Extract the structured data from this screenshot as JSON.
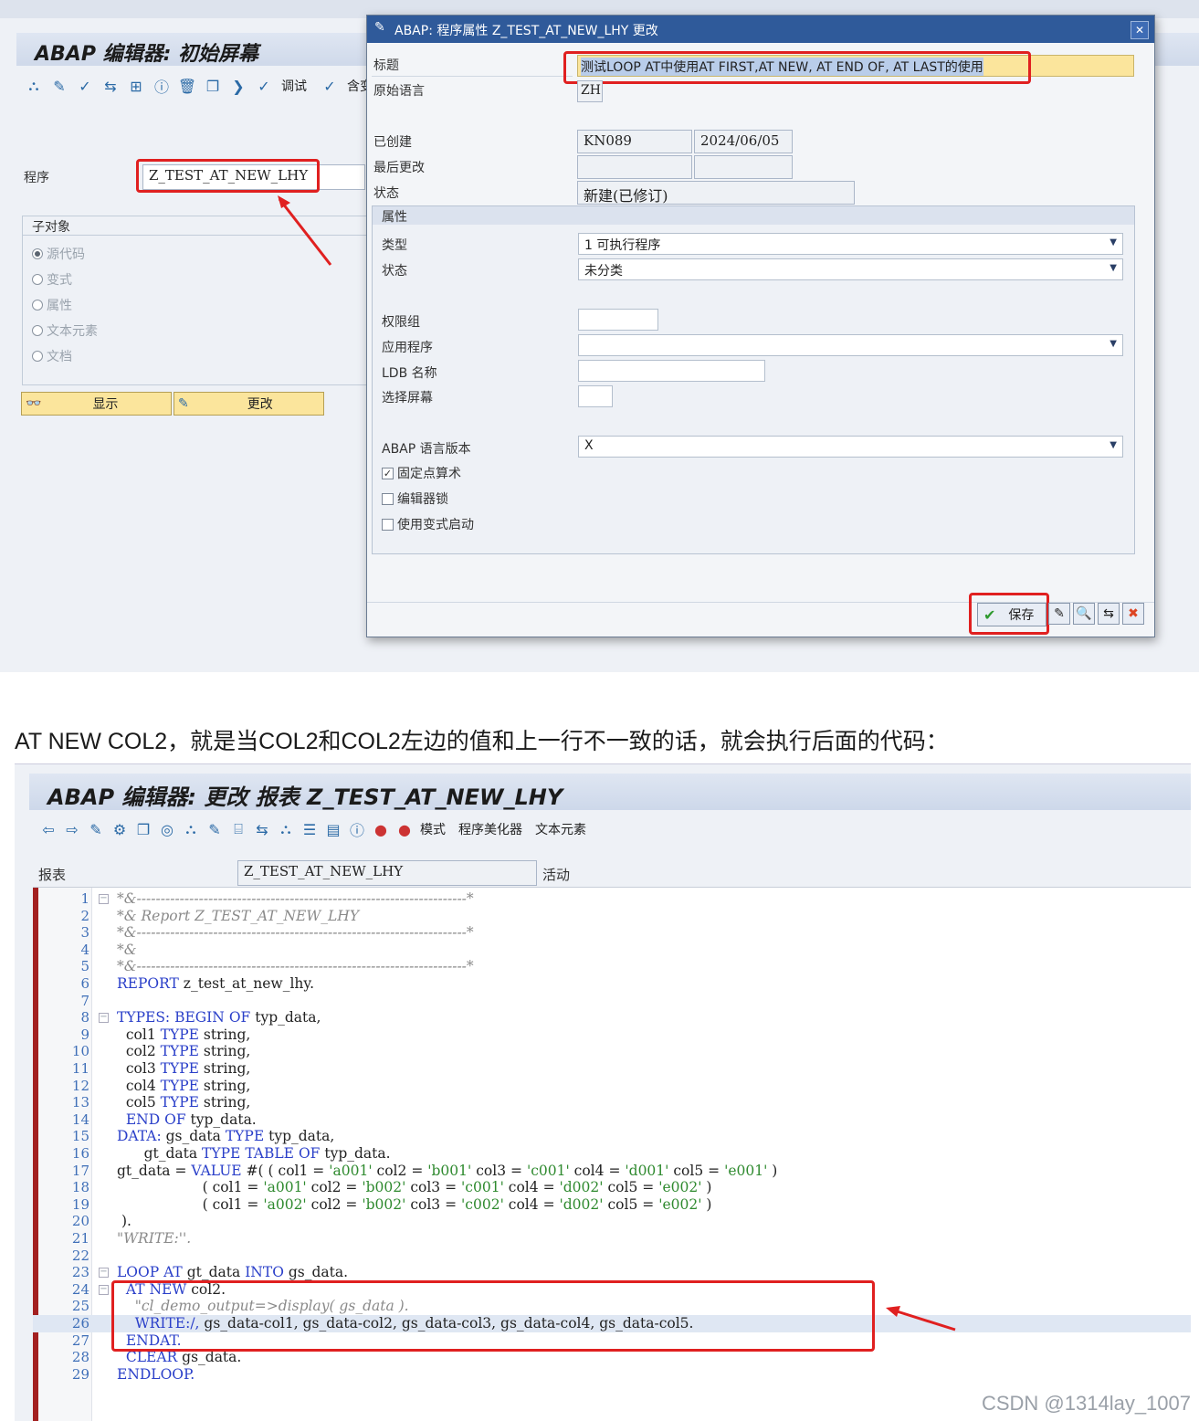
{
  "top": {
    "editor_title": "ABAP 编辑器: 初始屏幕",
    "toolbar": {
      "debug_label": "调试",
      "contains_label": "含变"
    },
    "program_label": "程序",
    "program_value": "Z_TEST_AT_NEW_LHY",
    "subobjects": {
      "title": "子对象",
      "options": [
        "源代码",
        "变式",
        "属性",
        "文本元素",
        "文档"
      ],
      "selected": "源代码"
    },
    "buttons": {
      "display": "显示",
      "change": "更改"
    },
    "dialog": {
      "title": "ABAP: 程序属性 Z_TEST_AT_NEW_LHY 更改",
      "title_label": "标题",
      "title_value": "测试LOOP AT中使用AT FIRST,AT NEW, AT END OF, AT LAST的使用",
      "orig_lang_label": "原始语言",
      "orig_lang_value": "ZH",
      "created_label": "已创建",
      "created_user": "KN089",
      "created_date": "2024/06/05",
      "last_changed_label": "最后更改",
      "status_label": "状态",
      "status_value": "新建(已修订)",
      "attributes_title": "属性",
      "type_label": "类型",
      "type_value": "1 可执行程序",
      "attr_status_label": "状态",
      "attr_status_value": "未分类",
      "auth_group_label": "权限组",
      "application_label": "应用程序",
      "ldb_label": "LDB 名称",
      "selscreen_label": "选择屏幕",
      "lang_version_label": "ABAP 语言版本",
      "lang_version_value": "X",
      "checkboxes": [
        {
          "label": "固定点算术",
          "checked": true
        },
        {
          "label": "编辑器锁",
          "checked": false
        },
        {
          "label": "使用变式启动",
          "checked": false
        }
      ],
      "save_label": "保存"
    }
  },
  "note": "AT NEW COL2，就是当COL2和COL2左边的值和上一行不一致的话，就会执行后面的代码：",
  "bottom": {
    "editor_title": "ABAP 编辑器: 更改 报表 Z_TEST_AT_NEW_LHY",
    "toolbar": {
      "mode_label": "模式",
      "beautifier_label": "程序美化器",
      "text_elements_label": "文本元素"
    },
    "report_label": "报表",
    "report_value": "Z_TEST_AT_NEW_LHY",
    "report_status": "活动",
    "code_lines": [
      "*&---------------------------------------------------------------------*",
      "*& Report Z_TEST_AT_NEW_LHY",
      "*&---------------------------------------------------------------------*",
      "*&",
      "*&---------------------------------------------------------------------*",
      "REPORT z_test_at_new_lhy.",
      "",
      "TYPES: BEGIN OF typ_data,",
      "  col1 TYPE string,",
      "  col2 TYPE string,",
      "  col3 TYPE string,",
      "  col4 TYPE string,",
      "  col5 TYPE string,",
      "  END OF typ_data.",
      "DATA: gs_data TYPE typ_data,",
      "      gt_data TYPE TABLE OF typ_data.",
      "gt_data = VALUE #( ( col1 = 'a001' col2 = 'b001' col3 = 'c001' col4 = 'd001' col5 = 'e001' )",
      "                   ( col1 = 'a001' col2 = 'b002' col3 = 'c001' col4 = 'd002' col5 = 'e002' )",
      "                   ( col1 = 'a002' col2 = 'b002' col3 = 'c002' col4 = 'd002' col5 = 'e002' )",
      " ).",
      "\"WRITE:''.",
      "",
      "LOOP AT gt_data INTO gs_data.",
      "  AT NEW col2.",
      "    \"cl_demo_output=>display( gs_data ).",
      "    WRITE:/, gs_data-col1, gs_data-col2, gs_data-col3, gs_data-col4, gs_data-col5.",
      "  ENDAT.",
      "  CLEAR gs_data.",
      "ENDLOOP."
    ]
  },
  "watermark": "CSDN @1314lay_1007",
  "colors": {
    "keyword": "#2a3fc9",
    "comment": "#8a8a8a",
    "string": "#2f8a2f",
    "highlight": "#e02020",
    "dialog_title": "#2f5a9a"
  }
}
